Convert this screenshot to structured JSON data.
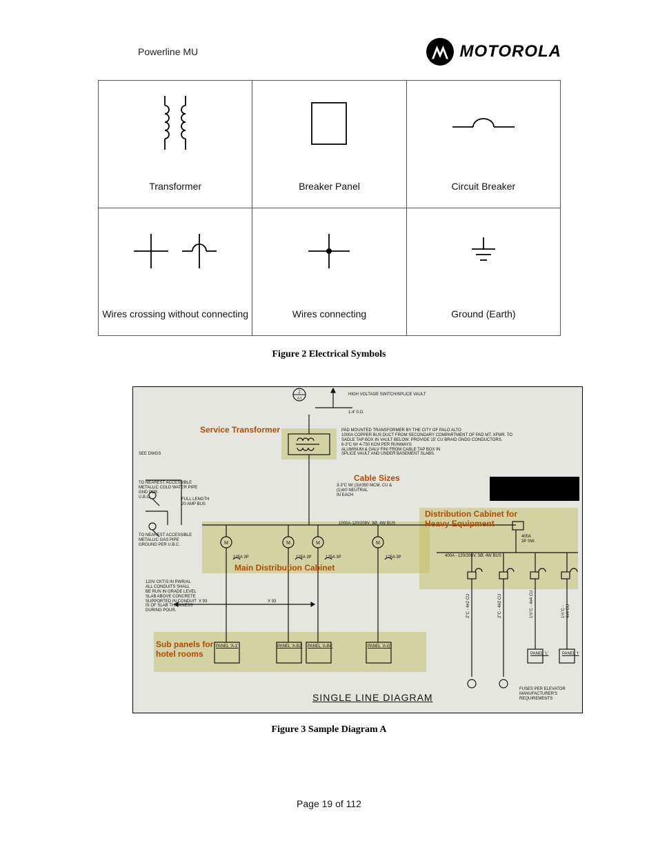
{
  "header": {
    "doc_title": "Powerline MU",
    "brand_name": "MOTOROLA"
  },
  "symbols": {
    "cells": [
      {
        "label": "Transformer"
      },
      {
        "label": "Breaker Panel"
      },
      {
        "label": "Circuit Breaker"
      },
      {
        "label": "Wires crossing without connecting"
      },
      {
        "label": "Wires connecting"
      },
      {
        "label": "Ground (Earth)"
      }
    ],
    "caption": "Figure 2 Electrical Symbols"
  },
  "diagram": {
    "caption": "Figure 3 Sample Diagram A",
    "title": "SINGLE LINE DIAGRAM",
    "labels": {
      "service_transformer": "Service Transformer",
      "cable_sizes": "Cable Sizes",
      "distribution_cabinet": "Distribution Cabinet for Heavy Equipment",
      "main_distribution": "Main Distribution Cabinet",
      "sub_panels": "Sub panels for hotel rooms"
    },
    "texts": {
      "hv_switch": "HIGH VOLTAGE SWITCH/SPLICE VAULT",
      "spacing": "1-4' 0.O.",
      "transformer_note": "PAD MOUNTED TRANSFORMER BY THE CITY OF PALO ALTO\n1000A COPPER BUS DUCT FROM SECONDARY COMPARTMENT OF PAD MT. XFMR. TO\nSADLE TAP BOX IN VAULT BELOW. PROVIDE 15' CU BRAID GNDG CONDUCTORS.\n6-3\"C W/ 4-750 KCM PER RUNWAYS\nALUMINUM & GALV FINI FROM CABLE TAP BOX IN\nSPLICE VAULT AND UNDER BASEMENT SLABS.",
      "cable_spec": "3-3\"C W/ (3)#350 MCM, CU &\n(1)4/0 NEUTRAL\nIN EACH",
      "main_spec": "1000A-120/208V, 3Ø, 4W BUS",
      "ground_note": "TO NEAREST ACCESSIBLE\nMETALLIC GAS PIPE\nGROUND PER U.B.C.",
      "water_note": "TO NEAREST ACCESSIBLE\nMETALLIC COLD WATER PIPE\nGND PER.\nU.B.C.",
      "full_length": "FULL LENGTH\n20 AMP BUS",
      "see_dwgs": "SEE DWGS",
      "dist_spec": "400A\n3P SW.",
      "dist_bus": "400A - 120/208V, 3Ø, 4W BUS",
      "conduit_note": "120V CKT/S IN PWR/AL\nALL CONDUITS SHALL\nBE RUN IN GRADE LEVEL\nSLAB ABOVE CONCRETE\nSUPPORTED IN CONDUIT\nIS OF SLAB THICKNESS\nDURING POUR.",
      "panel_labels": [
        "PANEL 'A-1'",
        "PANEL 'A-B2'",
        "PANEL 'A-B4'",
        "PANEL 'A-G'"
      ],
      "elevator_labels": [
        "PANEL 'L'",
        "PANEL 'I'"
      ],
      "elevator_note": "FUSES PER ELEVATOR\nMANUFACTURER'S\nREQUIREMENTS",
      "meter_labels": [
        "125A 3P",
        "125A 3P",
        "125A 3P",
        "125A 3P"
      ],
      "vertical_runs": [
        "2\"C - 4#2 CU",
        "2\"C - 4#2 CU",
        "1½\"C - 4#4 CU",
        "1½\"C - 4#4 CU"
      ],
      "x_runs": [
        "X 93",
        "X 93"
      ]
    }
  },
  "footer": {
    "page": "Page 19 of 112"
  }
}
